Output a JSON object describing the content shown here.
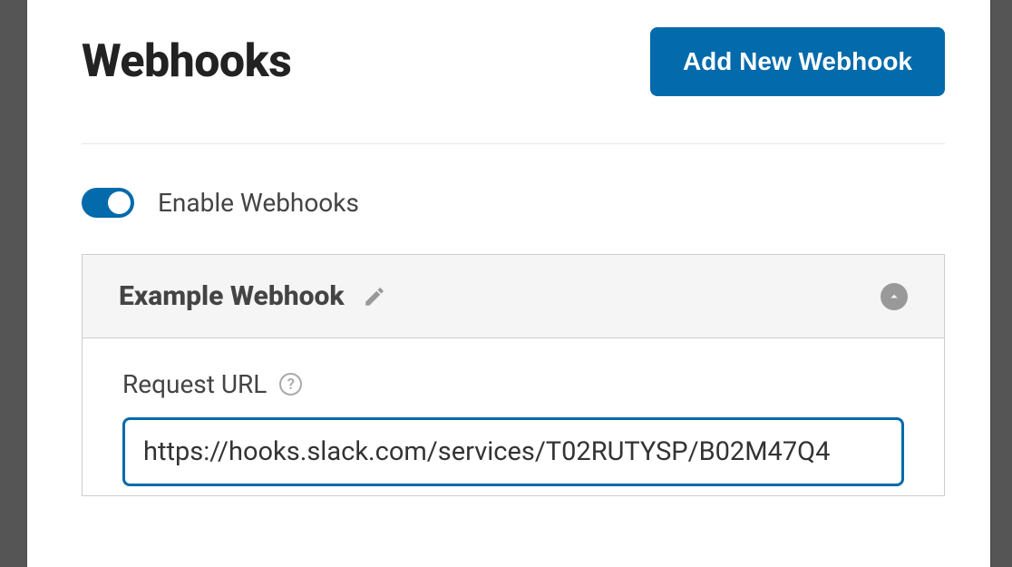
{
  "header": {
    "title": "Webhooks",
    "add_button": "Add New Webhook"
  },
  "toggle": {
    "enabled": true,
    "label": "Enable Webhooks"
  },
  "webhook": {
    "name": "Example Webhook",
    "request_url_label": "Request URL",
    "request_url_value": "https://hooks.slack.com/services/T02RUTYSP/B02M47Q4"
  },
  "icons": {
    "edit": "pencil-icon",
    "help": "?",
    "collapse": "chevron-up-icon"
  }
}
